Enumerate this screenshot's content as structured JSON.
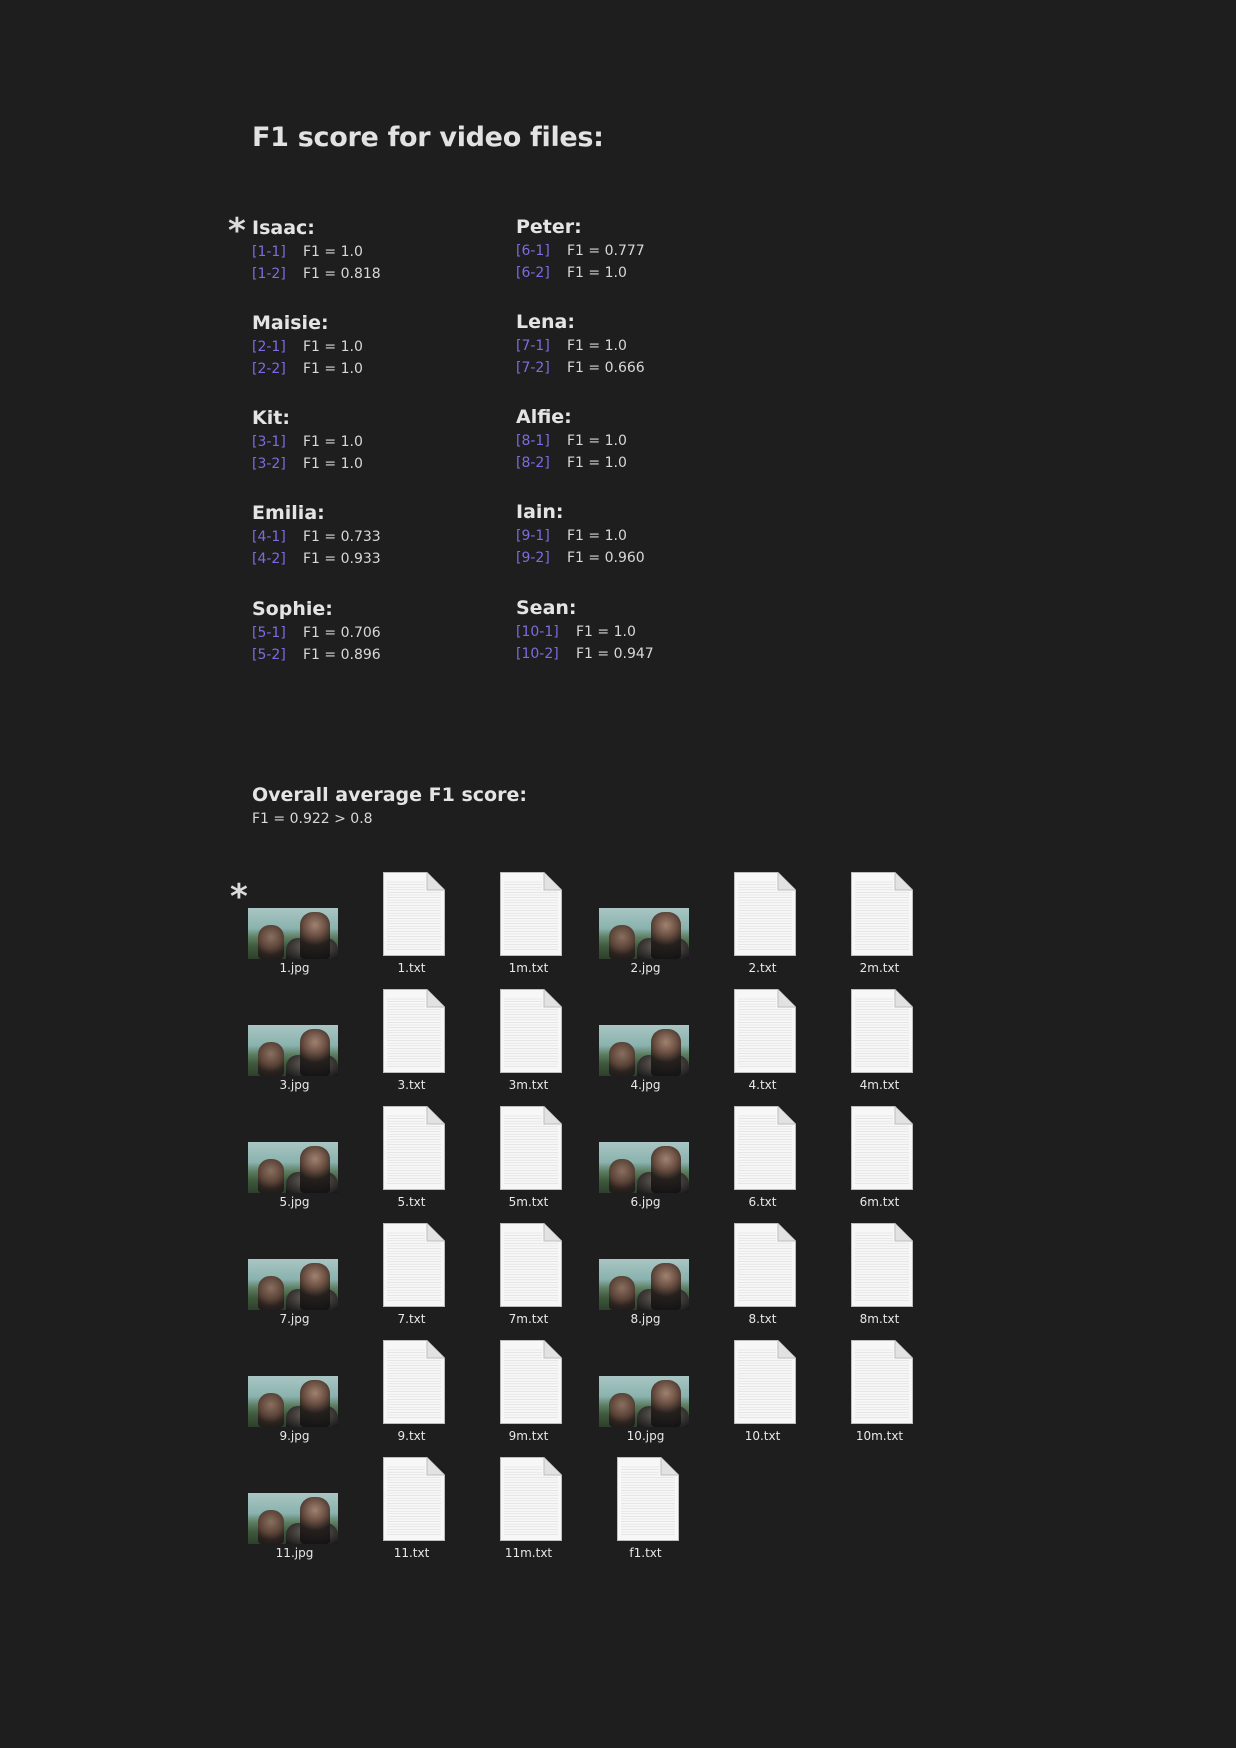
{
  "page": {
    "title": "F1 score for video files:",
    "asterisk": "*"
  },
  "people": [
    {
      "name": "Isaac:",
      "runs": [
        {
          "id": "[1-1]",
          "score": "F1 = 1.0"
        },
        {
          "id": "[1-2]",
          "score": "F1 = 0.818"
        }
      ]
    },
    {
      "name": "Maisie:",
      "runs": [
        {
          "id": "[2-1]",
          "score": "F1 = 1.0"
        },
        {
          "id": "[2-2]",
          "score": "F1 = 1.0"
        }
      ]
    },
    {
      "name": "Kit:",
      "runs": [
        {
          "id": "[3-1]",
          "score": "F1 = 1.0"
        },
        {
          "id": "[3-2]",
          "score": "F1 = 1.0"
        }
      ]
    },
    {
      "name": "Emilia:",
      "runs": [
        {
          "id": "[4-1]",
          "score": "F1 = 0.733"
        },
        {
          "id": "[4-2]",
          "score": "F1 = 0.933"
        }
      ]
    },
    {
      "name": "Sophie:",
      "runs": [
        {
          "id": "[5-1]",
          "score": "F1 = 0.706"
        },
        {
          "id": "[5-2]",
          "score": "F1 = 0.896"
        }
      ]
    },
    {
      "name": "Peter:",
      "runs": [
        {
          "id": "[6-1]",
          "score": "F1 = 0.777"
        },
        {
          "id": "[6-2]",
          "score": "F1 = 1.0"
        }
      ]
    },
    {
      "name": "Lena:",
      "runs": [
        {
          "id": "[7-1]",
          "score": "F1 = 1.0"
        },
        {
          "id": "[7-2]",
          "score": "F1 = 0.666"
        }
      ]
    },
    {
      "name": "Alfie:",
      "runs": [
        {
          "id": "[8-1]",
          "score": "F1 = 1.0"
        },
        {
          "id": "[8-2]",
          "score": "F1 = 1.0"
        }
      ]
    },
    {
      "name": "Iain:",
      "runs": [
        {
          "id": "[9-1]",
          "score": "F1 = 1.0"
        },
        {
          "id": "[9-2]",
          "score": "F1 = 0.960"
        }
      ]
    },
    {
      "name": "Sean:",
      "runs": [
        {
          "id": "[10-1]",
          "score": "F1 = 1.0"
        },
        {
          "id": "[10-2]",
          "score": "F1 = 0.947"
        }
      ]
    }
  ],
  "overall": {
    "title": "Overall average F1 score:",
    "value": "F1 = 0.922 > 0.8"
  },
  "files": [
    {
      "name": "1.jpg",
      "kind": "image"
    },
    {
      "name": "1.txt",
      "kind": "text"
    },
    {
      "name": "1m.txt",
      "kind": "text"
    },
    {
      "name": "2.jpg",
      "kind": "image"
    },
    {
      "name": "2.txt",
      "kind": "text"
    },
    {
      "name": "2m.txt",
      "kind": "text"
    },
    {
      "name": "3.jpg",
      "kind": "image"
    },
    {
      "name": "3.txt",
      "kind": "text"
    },
    {
      "name": "3m.txt",
      "kind": "text"
    },
    {
      "name": "4.jpg",
      "kind": "image"
    },
    {
      "name": "4.txt",
      "kind": "text"
    },
    {
      "name": "4m.txt",
      "kind": "text"
    },
    {
      "name": "5.jpg",
      "kind": "image"
    },
    {
      "name": "5.txt",
      "kind": "text"
    },
    {
      "name": "5m.txt",
      "kind": "text"
    },
    {
      "name": "6.jpg",
      "kind": "image"
    },
    {
      "name": "6.txt",
      "kind": "text"
    },
    {
      "name": "6m.txt",
      "kind": "text"
    },
    {
      "name": "7.jpg",
      "kind": "image"
    },
    {
      "name": "7.txt",
      "kind": "text"
    },
    {
      "name": "7m.txt",
      "kind": "text"
    },
    {
      "name": "8.jpg",
      "kind": "image"
    },
    {
      "name": "8.txt",
      "kind": "text"
    },
    {
      "name": "8m.txt",
      "kind": "text"
    },
    {
      "name": "9.jpg",
      "kind": "image"
    },
    {
      "name": "9.txt",
      "kind": "text"
    },
    {
      "name": "9m.txt",
      "kind": "text"
    },
    {
      "name": "10.jpg",
      "kind": "image"
    },
    {
      "name": "10.txt",
      "kind": "text"
    },
    {
      "name": "10m.txt",
      "kind": "text"
    },
    {
      "name": "11.jpg",
      "kind": "image"
    },
    {
      "name": "11.txt",
      "kind": "text"
    },
    {
      "name": "11m.txt",
      "kind": "text"
    },
    {
      "name": "f1.txt",
      "kind": "text"
    }
  ],
  "colors": {
    "background": "#1e1e1e",
    "link": "#7b6de0",
    "text": "#d8d8d8"
  }
}
